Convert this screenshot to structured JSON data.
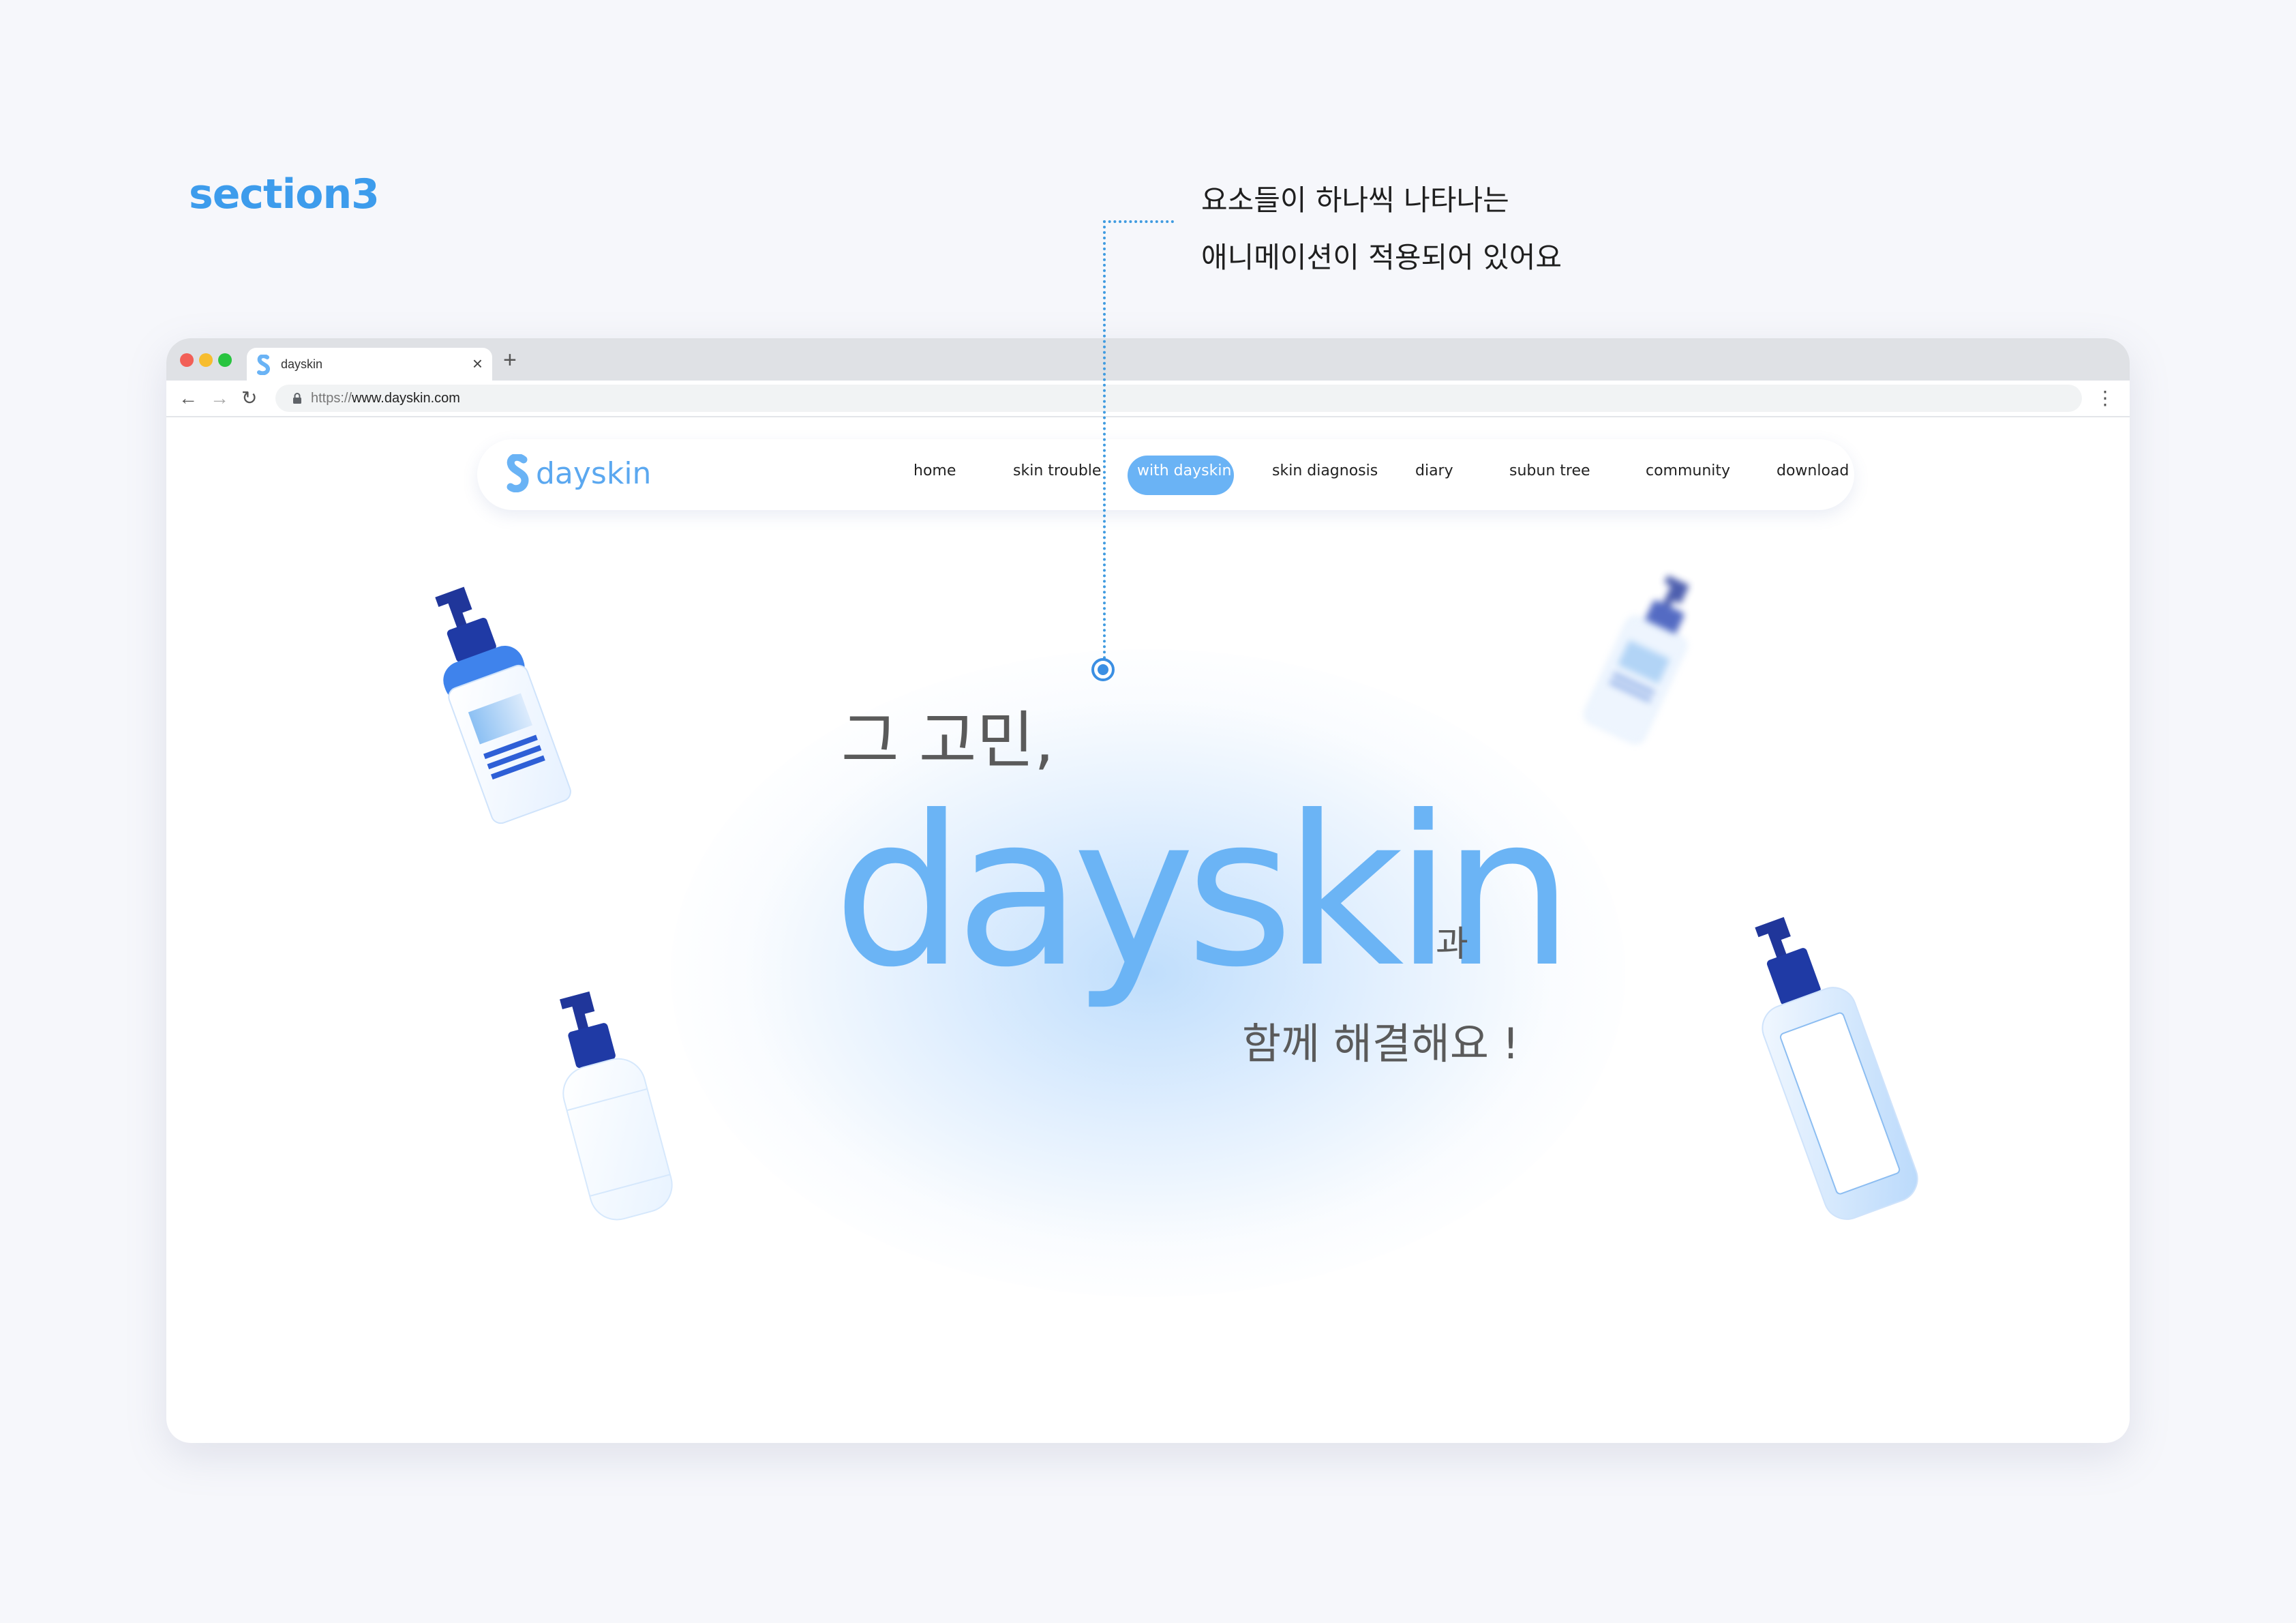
{
  "section_label": "section3",
  "annotation": {
    "line1": "요소들이 하나씩 나타나는",
    "line2": "애니메이션이 적용되어 있어요"
  },
  "browser": {
    "tab_title": "dayskin",
    "tab_close": "×",
    "new_tab": "+",
    "url_scheme": "https://",
    "url_host": "www.dayskin.com",
    "back": "←",
    "forward": "→",
    "reload": "↻",
    "menu": "⋮"
  },
  "site": {
    "logo_text": "dayskin",
    "menu": {
      "home": "home",
      "skin_trouble": "skin trouble",
      "with_dayskin": "with dayskin",
      "skin_diagnosis": "skin diagnosis",
      "diary": "diary",
      "subun_tree": "subun tree",
      "community": "community",
      "download": "download"
    },
    "active_menu": "with dayskin",
    "accent_color": "#6ab3f5"
  },
  "hero": {
    "line1": "그 고민,",
    "brand": "dayskin",
    "suffix": "과",
    "line3": "함께 해결해요 !"
  },
  "icons": {
    "logo": "s-logo-icon",
    "lock": "lock-icon",
    "bottles": [
      "pump-bottle-icon",
      "pump-bottle-icon",
      "pump-bottle-icon",
      "pump-bottle-icon"
    ]
  }
}
